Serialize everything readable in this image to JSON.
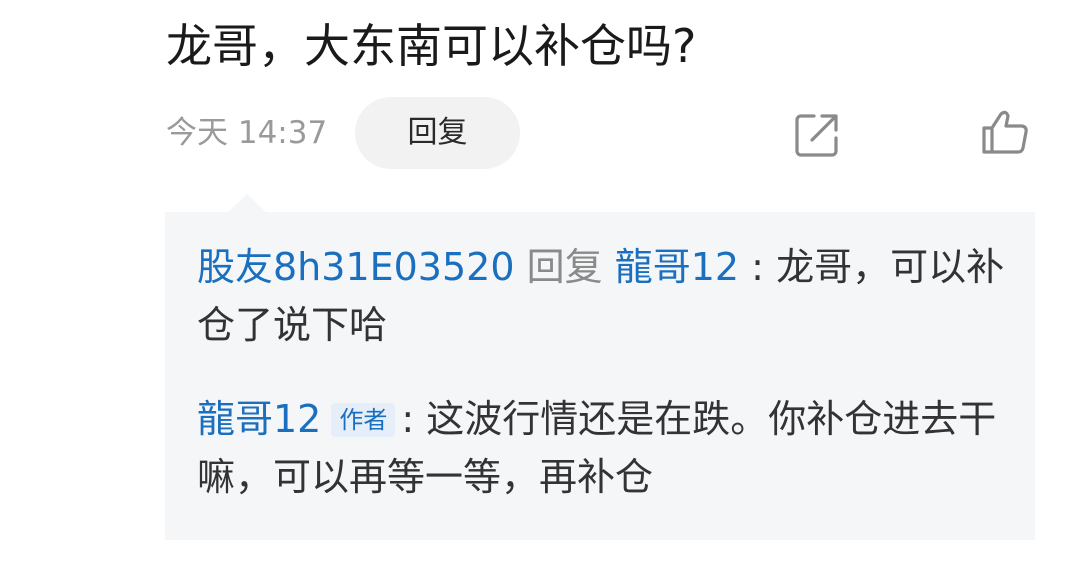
{
  "comment": {
    "text": "龙哥，大东南可以补仓吗?",
    "time": "今天 14:37",
    "reply_label": "回复",
    "share_icon": "share-icon",
    "like_icon": "thumbs-up-icon"
  },
  "replies": [
    {
      "user": "股友8h31E03520",
      "reply_word": "回复",
      "target_user": "龍哥12",
      "separator": ":",
      "text": "龙哥，可以补仓了说下哈"
    },
    {
      "user": "龍哥12",
      "badge": "作者",
      "separator": ":",
      "text": "这波行情还是在跌。你补仓进去干嘛，可以再等一等，再补仓"
    }
  ],
  "colors": {
    "username": "#1a6fbf",
    "meta": "#9a9a9a",
    "reply_box_bg": "#f5f6f8",
    "button_bg": "#f2f2f2"
  }
}
